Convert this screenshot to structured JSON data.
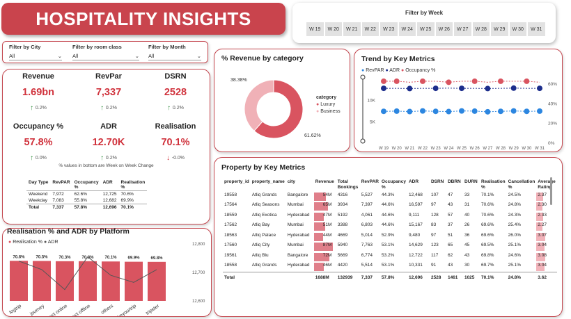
{
  "title": "HOSPITALITY INSIGHTS",
  "week_filter": {
    "label": "Filter by Week",
    "weeks": [
      "W 19",
      "W 20",
      "W 21",
      "W 22",
      "W 23",
      "W 24",
      "W 25",
      "W 26",
      "W 27",
      "W 28",
      "W 29",
      "W 30",
      "W 31"
    ]
  },
  "filters": [
    {
      "label": "Filter by City",
      "value": "All"
    },
    {
      "label": "Filter by room class",
      "value": "All"
    },
    {
      "label": "Filter by Month",
      "value": "All"
    }
  ],
  "kpis": [
    {
      "label": "Revenue",
      "value": "1.69bn",
      "change": "0.2%",
      "dir": "up"
    },
    {
      "label": "RevPar",
      "value": "7,337",
      "change": "0.2%",
      "dir": "up"
    },
    {
      "label": "DSRN",
      "value": "2528",
      "change": "0.2%",
      "dir": "up"
    },
    {
      "label": "Occupancy %",
      "value": "57.8%",
      "change": "0.0%",
      "dir": "up"
    },
    {
      "label": "ADR",
      "value": "12.70K",
      "change": "0.2%",
      "dir": "up"
    },
    {
      "label": "Realisation",
      "value": "70.1%",
      "change": "-0.0%",
      "dir": "down"
    }
  ],
  "kpi_note": "% values in bottom are Week on Week Change",
  "daytype_table": {
    "headers": [
      "Day Type",
      "RevPAR",
      "Occupancy %",
      "ADR",
      "Realisation %"
    ],
    "rows": [
      [
        "Weekend",
        "7,972",
        "62.6%",
        "12,725",
        "70.6%"
      ],
      [
        "Weekday",
        "7,083",
        "55.8%",
        "12,682",
        "69.9%"
      ]
    ],
    "total": [
      "Total",
      "7,337",
      "57.8%",
      "12,696",
      "70.1%"
    ]
  },
  "platform": {
    "title": "Realisation % and ADR by Platform",
    "legend": [
      "Realisation %",
      "ADR"
    ],
    "y2_ticks": [
      "12,800",
      "12,700",
      "12,600"
    ]
  },
  "revenue_category": {
    "title": "% Revenue by category",
    "legend_title": "category",
    "legend": [
      "Luxury",
      "Business"
    ],
    "labels": [
      "61.62%",
      "38.38%"
    ]
  },
  "trend": {
    "title": "Trend by Key Metrics",
    "legend": [
      "RevPAR",
      "ADR",
      "Occupancy %"
    ],
    "y_ticks": [
      "10K",
      "5K"
    ],
    "y2_ticks": [
      "60%",
      "40%",
      "20%",
      "0%"
    ]
  },
  "property": {
    "title": "Property by Key Metrics",
    "headers": [
      "property_id",
      "property_name",
      "city",
      "Revenue",
      "Total Bookings",
      "RevPAR",
      "Occupancy %",
      "ADR",
      "DSRN",
      "DBRN",
      "DURN",
      "Realisation %",
      "Cancellation %",
      "Average Rating"
    ],
    "rows": [
      [
        "19558",
        "Atliq Grands",
        "Bangalore",
        "54M",
        "4316",
        "5,527",
        "44.3%",
        "12,468",
        "107",
        "47",
        "33",
        "70.1%",
        "24.5%",
        "2.37"
      ],
      [
        "17564",
        "Atliq Seasons",
        "Mumbai",
        "65M",
        "3934",
        "7,397",
        "44.6%",
        "16,597",
        "97",
        "43",
        "31",
        "70.6%",
        "24.8%",
        "2.30"
      ],
      [
        "18559",
        "Atliq Exotica",
        "Hyderabad",
        "47M",
        "5192",
        "4,061",
        "44.6%",
        "9,111",
        "128",
        "57",
        "40",
        "70.6%",
        "24.3%",
        "2.33"
      ],
      [
        "17562",
        "Atliq Bay",
        "Mumbai",
        "51M",
        "3388",
        "6,803",
        "44.6%",
        "15,167",
        "83",
        "37",
        "26",
        "69.6%",
        "25.4%",
        "2.27"
      ],
      [
        "18563",
        "Atliq Palace",
        "Hyderabad",
        "44M",
        "4669",
        "5,014",
        "52.9%",
        "9,480",
        "97",
        "51",
        "36",
        "69.6%",
        "26.0%",
        "3.07"
      ],
      [
        "17560",
        "Atliq City",
        "Mumbai",
        "87M",
        "5940",
        "7,763",
        "53.1%",
        "14,629",
        "123",
        "65",
        "45",
        "69.5%",
        "25.1%",
        "3.04"
      ],
      [
        "19561",
        "Atliq Blu",
        "Bangalore",
        "72M",
        "5669",
        "6,774",
        "53.2%",
        "12,722",
        "117",
        "62",
        "43",
        "69.8%",
        "24.6%",
        "3.08"
      ],
      [
        "18558",
        "Atliq Grands",
        "Hyderabad",
        "46M",
        "4420",
        "5,514",
        "53.1%",
        "10,331",
        "91",
        "43",
        "30",
        "69.7%",
        "25.1%",
        "3.04"
      ]
    ],
    "total": [
      "Total",
      "",
      "",
      "1688M",
      "132939",
      "7,337",
      "57.8%",
      "12,696",
      "2528",
      "1461",
      "1025",
      "70.1%",
      "24.8%",
      "3.62"
    ]
  },
  "chart_data": [
    {
      "type": "pie",
      "title": "% Revenue by category",
      "categories": [
        "Luxury",
        "Business"
      ],
      "values": [
        61.62,
        38.38
      ],
      "colors": [
        "#d95460",
        "#f0b1b7"
      ],
      "legend": "right"
    },
    {
      "type": "line",
      "title": "Trend by Key Metrics",
      "x": [
        "W 19",
        "W 20",
        "W 21",
        "W 22",
        "W 23",
        "W 24",
        "W 25",
        "W 26",
        "W 27",
        "W 28",
        "W 29",
        "W 30",
        "W 31"
      ],
      "series": [
        {
          "name": "RevPAR",
          "axis": "left",
          "values": [
            7300,
            7350,
            7250,
            7400,
            7300,
            7250,
            7400,
            7350,
            7200,
            7300,
            7400,
            7300,
            7350
          ],
          "color": "#2c86e0"
        },
        {
          "name": "ADR",
          "axis": "left",
          "values": [
            12700,
            12700,
            12650,
            12700,
            12700,
            12750,
            12700,
            12700,
            12650,
            12700,
            12750,
            12700,
            12700
          ],
          "color": "#1d2e8c"
        },
        {
          "name": "Occupancy %",
          "axis": "right",
          "values": [
            58,
            58,
            57,
            58,
            58,
            57,
            58,
            58,
            57,
            58,
            58,
            58,
            57
          ],
          "color": "#d95460"
        }
      ],
      "ylim": [
        0,
        15000
      ],
      "y2lim": [
        0,
        65
      ]
    },
    {
      "type": "bar",
      "title": "Realisation % and ADR by Platform",
      "categories": [
        "logtrip",
        "journey",
        "direct online",
        "direct offline",
        "others",
        "makeyourtrip",
        "tripster"
      ],
      "series": [
        {
          "name": "Realisation %",
          "type": "bar",
          "values": [
            70.6,
            70.5,
            70.3,
            70.3,
            70.1,
            69.9,
            69.8
          ],
          "labels": [
            "70.6%",
            "70.5%",
            "70.3%",
            "70.3%",
            "70.1%",
            "69.9%",
            "69.8%"
          ],
          "color": "#d95460"
        },
        {
          "name": "ADR",
          "type": "line",
          "values": [
            12740,
            12710,
            12640,
            12755,
            12690,
            12665,
            12710
          ],
          "color": "#555555"
        }
      ],
      "y2lim": [
        12600,
        12800
      ]
    }
  ]
}
